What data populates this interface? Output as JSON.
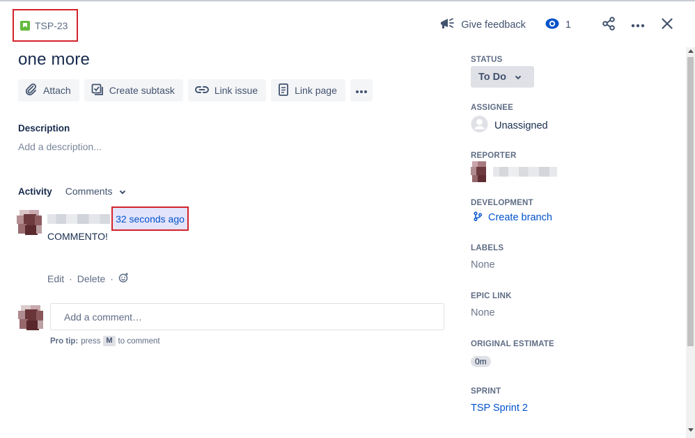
{
  "header": {
    "issue_key": "TSP-23",
    "feedback_label": "Give feedback",
    "watch_count": "1"
  },
  "issue": {
    "title": "one more"
  },
  "toolbar": {
    "attach": "Attach",
    "create_subtask": "Create subtask",
    "link_issue": "Link issue",
    "link_page": "Link page"
  },
  "description": {
    "label": "Description",
    "placeholder": "Add a description..."
  },
  "activity": {
    "label": "Activity",
    "filter": "Comments",
    "comment": {
      "timestamp": "32 seconds ago",
      "text": "COMMENTO!",
      "edit": "Edit",
      "delete": "Delete",
      "separator": "·"
    },
    "add_comment_placeholder": "Add a comment…",
    "protip_label": "Pro tip:",
    "protip_press": "press",
    "protip_key": "M",
    "protip_suffix": "to comment"
  },
  "sidebar": {
    "status_label": "STATUS",
    "status_value": "To Do",
    "assignee_label": "ASSIGNEE",
    "assignee_value": "Unassigned",
    "reporter_label": "REPORTER",
    "development_label": "DEVELOPMENT",
    "create_branch": "Create branch",
    "labels_label": "LABELS",
    "labels_value": "None",
    "epic_link_label": "EPIC LINK",
    "epic_link_value": "None",
    "original_estimate_label": "ORIGINAL ESTIMATE",
    "original_estimate_value": "0m",
    "sprint_label": "SPRINT",
    "sprint_value": "TSP Sprint 2"
  },
  "colors": {
    "link": "#0052cc",
    "highlight_border": "#d3222a",
    "story_icon": "#63ba3c"
  }
}
